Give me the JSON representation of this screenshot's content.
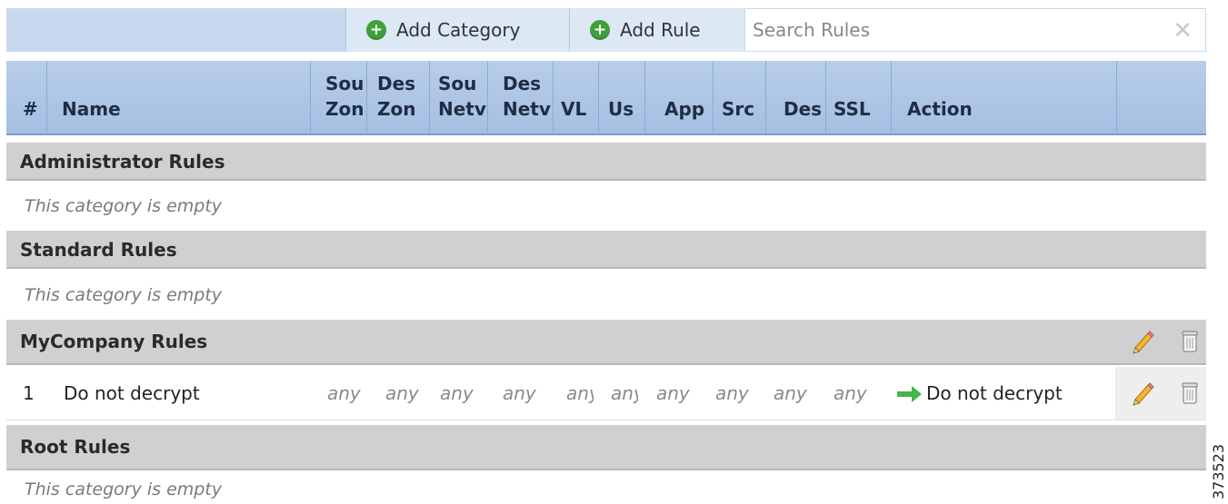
{
  "toolbar": {
    "add_category_label": "Add Category",
    "add_rule_label": "Add Rule",
    "search_placeholder": "Search Rules",
    "search_value": ""
  },
  "columns": {
    "num": "#",
    "name": "Name",
    "source_zones": [
      "Sou",
      "Zon"
    ],
    "dest_zones": [
      "Des",
      "Zon"
    ],
    "source_networks": [
      "Sou",
      "Netv"
    ],
    "dest_networks": [
      "Des",
      "Netv"
    ],
    "vlan": "VL",
    "users": "Us",
    "app": "App",
    "src": "Src",
    "des": "Des",
    "ssl": "SSL",
    "action": "Action"
  },
  "categories": [
    {
      "title": "Administrator Rules",
      "empty_text": "This category is empty"
    },
    {
      "title": "Standard Rules",
      "empty_text": "This category is empty"
    },
    {
      "title": "MyCompany Rules"
    },
    {
      "title": "Root Rules",
      "empty_text": "This category is empty"
    }
  ],
  "rules": [
    {
      "number": "1",
      "name": "Do not decrypt",
      "cells": [
        "any",
        "any",
        "any",
        "any",
        "any",
        "any",
        "any",
        "any",
        "any",
        "any"
      ],
      "action": "Do not decrypt"
    }
  ],
  "watermark": "373523",
  "colors": {
    "toolbar_bg": "#c7d8ef",
    "header_bg": "#b0c7e6",
    "category_bg": "#d0d0d0",
    "add_icon": "#3da23a",
    "action_arrow": "#3cb34a",
    "pencil": "#e8a21a"
  },
  "icons": {
    "add_category": "plus-circle-icon",
    "add_rule": "plus-circle-icon",
    "clear_search": "close-icon",
    "edit": "pencil-icon",
    "delete": "trash-icon",
    "action": "arrow-right-icon"
  }
}
